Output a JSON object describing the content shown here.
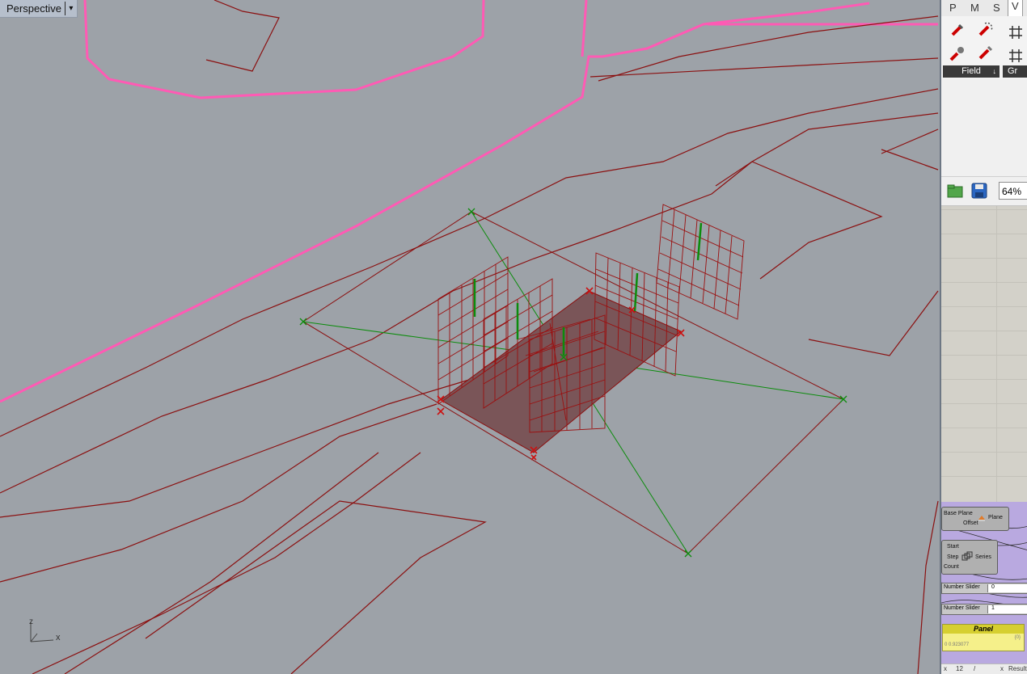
{
  "viewport": {
    "name": "Perspective",
    "axis_x": "x",
    "axis_y": "z"
  },
  "panel": {
    "tabs": [
      "P",
      "M",
      "S",
      "V"
    ],
    "active_tab": "V",
    "ribbon_groups": [
      "Field",
      "Gr"
    ],
    "zoom": "64%"
  },
  "canvas": {
    "plane_comp": {
      "inputs": [
        "Base Plane",
        "Offset"
      ],
      "name": "Plane"
    },
    "series_comp": {
      "inputs": [
        "Start",
        "Step",
        "Count"
      ],
      "name": "Series"
    },
    "sliders": [
      {
        "label": "Number Slider",
        "value": "0"
      },
      {
        "label": "Number Slider",
        "value": "1"
      }
    ],
    "panel_comp": {
      "title": "Panel",
      "path": "{0}",
      "output": "0  0.923077"
    }
  },
  "status": {
    "left": "x",
    "mid": "12",
    "mid2": "/",
    "right_x": "x",
    "right": "Result"
  },
  "colors": {
    "viewport_bg": "#9da2a8",
    "curve_red": "#8b1010",
    "curve_pink": "#ff5ab4",
    "green": "#0c8c0c"
  }
}
